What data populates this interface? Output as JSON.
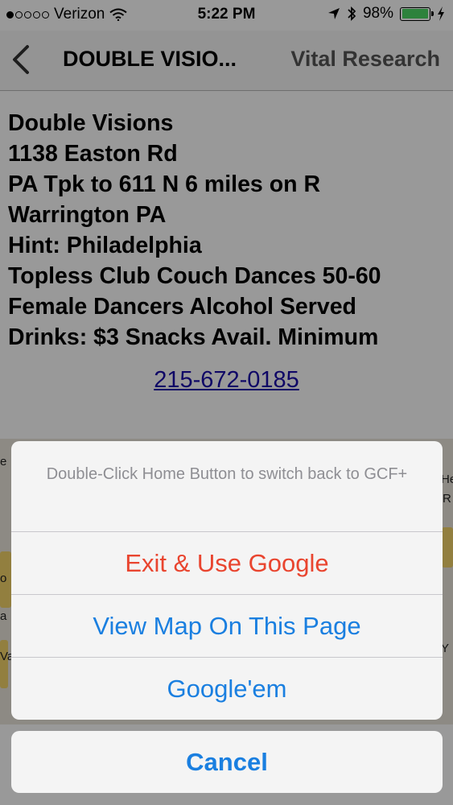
{
  "status_bar": {
    "carrier": "Verizon",
    "time": "5:22 PM",
    "battery": "98%",
    "battery_level": 0.98,
    "signal_bars_filled": 1,
    "signal_bars_total": 5
  },
  "nav": {
    "title": "DOUBLE VISIO...",
    "right_label": "Vital Research"
  },
  "details": {
    "lines": [
      "Double Visions",
      "1138 Easton Rd",
      "PA Tpk to 611 N 6 miles on R",
      "Warrington PA",
      "Hint: Philadelphia",
      "Topless Club Couch Dances 50-60",
      "Female Dancers Alcohol Served",
      "Drinks: $3 Snacks Avail. Minimum"
    ],
    "phone": "215-672-0185"
  },
  "map_edge": {
    "left": [
      "e",
      "o",
      "a",
      "Va"
    ],
    "right": [
      "He",
      "R",
      "Y"
    ]
  },
  "action_sheet": {
    "title": "Double-Click Home Button to switch back to GCF+",
    "options": [
      {
        "label": "Exit & Use Google",
        "style": "destructive"
      },
      {
        "label": "View Map On This Page",
        "style": "normal"
      },
      {
        "label": "Google'em",
        "style": "normal"
      }
    ],
    "cancel": "Cancel"
  },
  "colors": {
    "destructive": "#e9452f",
    "action": "#1a7fe0",
    "link": "#1a0dab",
    "battery": "#4cd964"
  }
}
